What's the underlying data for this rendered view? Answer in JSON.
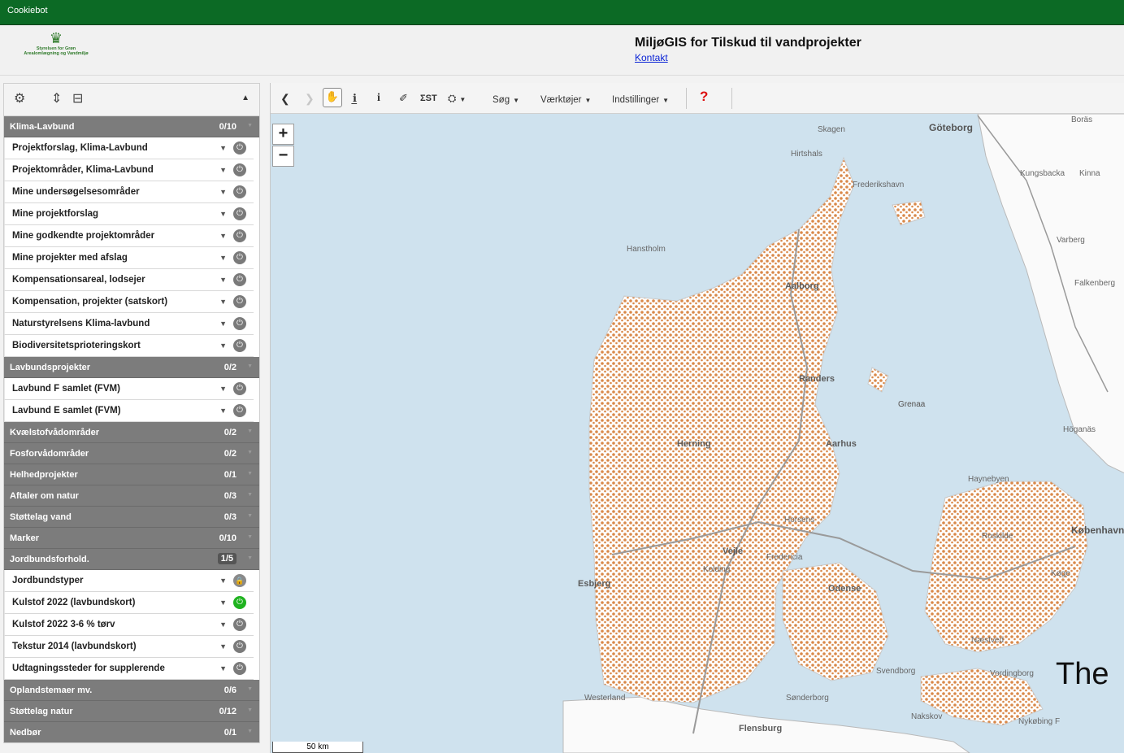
{
  "cookiebar": {
    "label": "Cookiebot"
  },
  "header": {
    "logo_line1": "Styrelsen for Grøn",
    "logo_line2": "Arealomlægning og Vandmiljø",
    "title": "MiljøGIS for Tilskud til vandprojekter",
    "contact": "Kontakt"
  },
  "layers": [
    {
      "type": "group",
      "label": "Klima-Lavbund",
      "count": "0/10"
    },
    {
      "type": "layer",
      "label": "Projektforslag, Klima-Lavbund",
      "state": "off"
    },
    {
      "type": "layer",
      "label": "Projektområder, Klima-Lavbund",
      "state": "off"
    },
    {
      "type": "layer",
      "label": "Mine undersøgelsesområder",
      "state": "off"
    },
    {
      "type": "layer",
      "label": "Mine projektforslag",
      "state": "off"
    },
    {
      "type": "layer",
      "label": "Mine godkendte projektområder",
      "state": "off"
    },
    {
      "type": "layer",
      "label": "Mine projekter med afslag",
      "state": "off"
    },
    {
      "type": "layer",
      "label": "Kompensationsareal, lodsejer",
      "state": "off"
    },
    {
      "type": "layer",
      "label": "Kompensation, projekter (satskort)",
      "state": "off"
    },
    {
      "type": "layer",
      "label": "Naturstyrelsens Klima-lavbund",
      "state": "off"
    },
    {
      "type": "layer",
      "label": "Biodiversitetsprioteringskort",
      "state": "off"
    },
    {
      "type": "group",
      "label": "Lavbundsprojekter",
      "count": "0/2"
    },
    {
      "type": "layer",
      "label": "Lavbund F samlet (FVM)",
      "state": "off"
    },
    {
      "type": "layer",
      "label": "Lavbund E samlet (FVM)",
      "state": "off"
    },
    {
      "type": "group",
      "label": "Kvælstofvådområder",
      "count": "0/2"
    },
    {
      "type": "group",
      "label": "Fosforvådområder",
      "count": "0/2"
    },
    {
      "type": "group",
      "label": "Helhedprojekter",
      "count": "0/1"
    },
    {
      "type": "group",
      "label": "Aftaler om natur",
      "count": "0/3"
    },
    {
      "type": "group",
      "label": "Støttelag vand",
      "count": "0/3"
    },
    {
      "type": "group",
      "label": "Marker",
      "count": "0/10"
    },
    {
      "type": "group",
      "label": "Jordbundsforhold.",
      "count": "1/5",
      "boxed": true
    },
    {
      "type": "layer",
      "label": "Jordbundstyper",
      "state": "lock"
    },
    {
      "type": "layer",
      "label": "Kulstof 2022 (lavbundskort)",
      "state": "on"
    },
    {
      "type": "layer",
      "label": "Kulstof 2022 3-6 % tørv",
      "state": "off"
    },
    {
      "type": "layer",
      "label": "Tekstur 2014 (lavbundskort)",
      "state": "off"
    },
    {
      "type": "layer",
      "label": "Udtagningssteder for supplerende",
      "state": "off"
    },
    {
      "type": "group",
      "label": "Oplandstemaer mv.",
      "count": "0/6"
    },
    {
      "type": "group",
      "label": "Støttelag natur",
      "count": "0/12"
    },
    {
      "type": "group",
      "label": "Nedbør",
      "count": "0/1"
    }
  ],
  "map_toolbar": {
    "search": "Søg",
    "tools": "Værktøjer",
    "settings": "Indstillinger",
    "help": "?"
  },
  "map_labels": [
    {
      "text": "Skagen"
    },
    {
      "text": "Göteborg"
    },
    {
      "text": "Hirtshals"
    },
    {
      "text": "Frederikshavn"
    },
    {
      "text": "Hanstholm"
    },
    {
      "text": "Aalborg"
    },
    {
      "text": "Randers"
    },
    {
      "text": "Grenaa"
    },
    {
      "text": "Herning"
    },
    {
      "text": "Aarhus"
    },
    {
      "text": "Horsens"
    },
    {
      "text": "Vejle"
    },
    {
      "text": "Kolding"
    },
    {
      "text": "Fredericia"
    },
    {
      "text": "Esbjerg"
    },
    {
      "text": "Odense"
    },
    {
      "text": "Svendborg"
    },
    {
      "text": "Sønderborg"
    },
    {
      "text": "Flensburg"
    },
    {
      "text": "Westerland"
    },
    {
      "text": "Varberg"
    },
    {
      "text": "Falkenberg"
    },
    {
      "text": "Kungsbacka"
    },
    {
      "text": "Kinna"
    },
    {
      "text": "Boräs"
    },
    {
      "text": "Höganäs"
    },
    {
      "text": "Haynebyen"
    },
    {
      "text": "Køge"
    },
    {
      "text": "Roskilde"
    },
    {
      "text": "København"
    },
    {
      "text": "Næstved"
    },
    {
      "text": "Vordingborg"
    },
    {
      "text": "Nykøbing F"
    },
    {
      "text": "Nakskov"
    },
    {
      "text": "Grenaa"
    }
  ],
  "overlay_text": "The",
  "scale": "50 km",
  "colors": {
    "cookiebar": "#0c6a25",
    "lowland": "#d9894a",
    "sea": "#cfe2ee",
    "land": "#ffffff",
    "power_on": "#1fb21f"
  }
}
